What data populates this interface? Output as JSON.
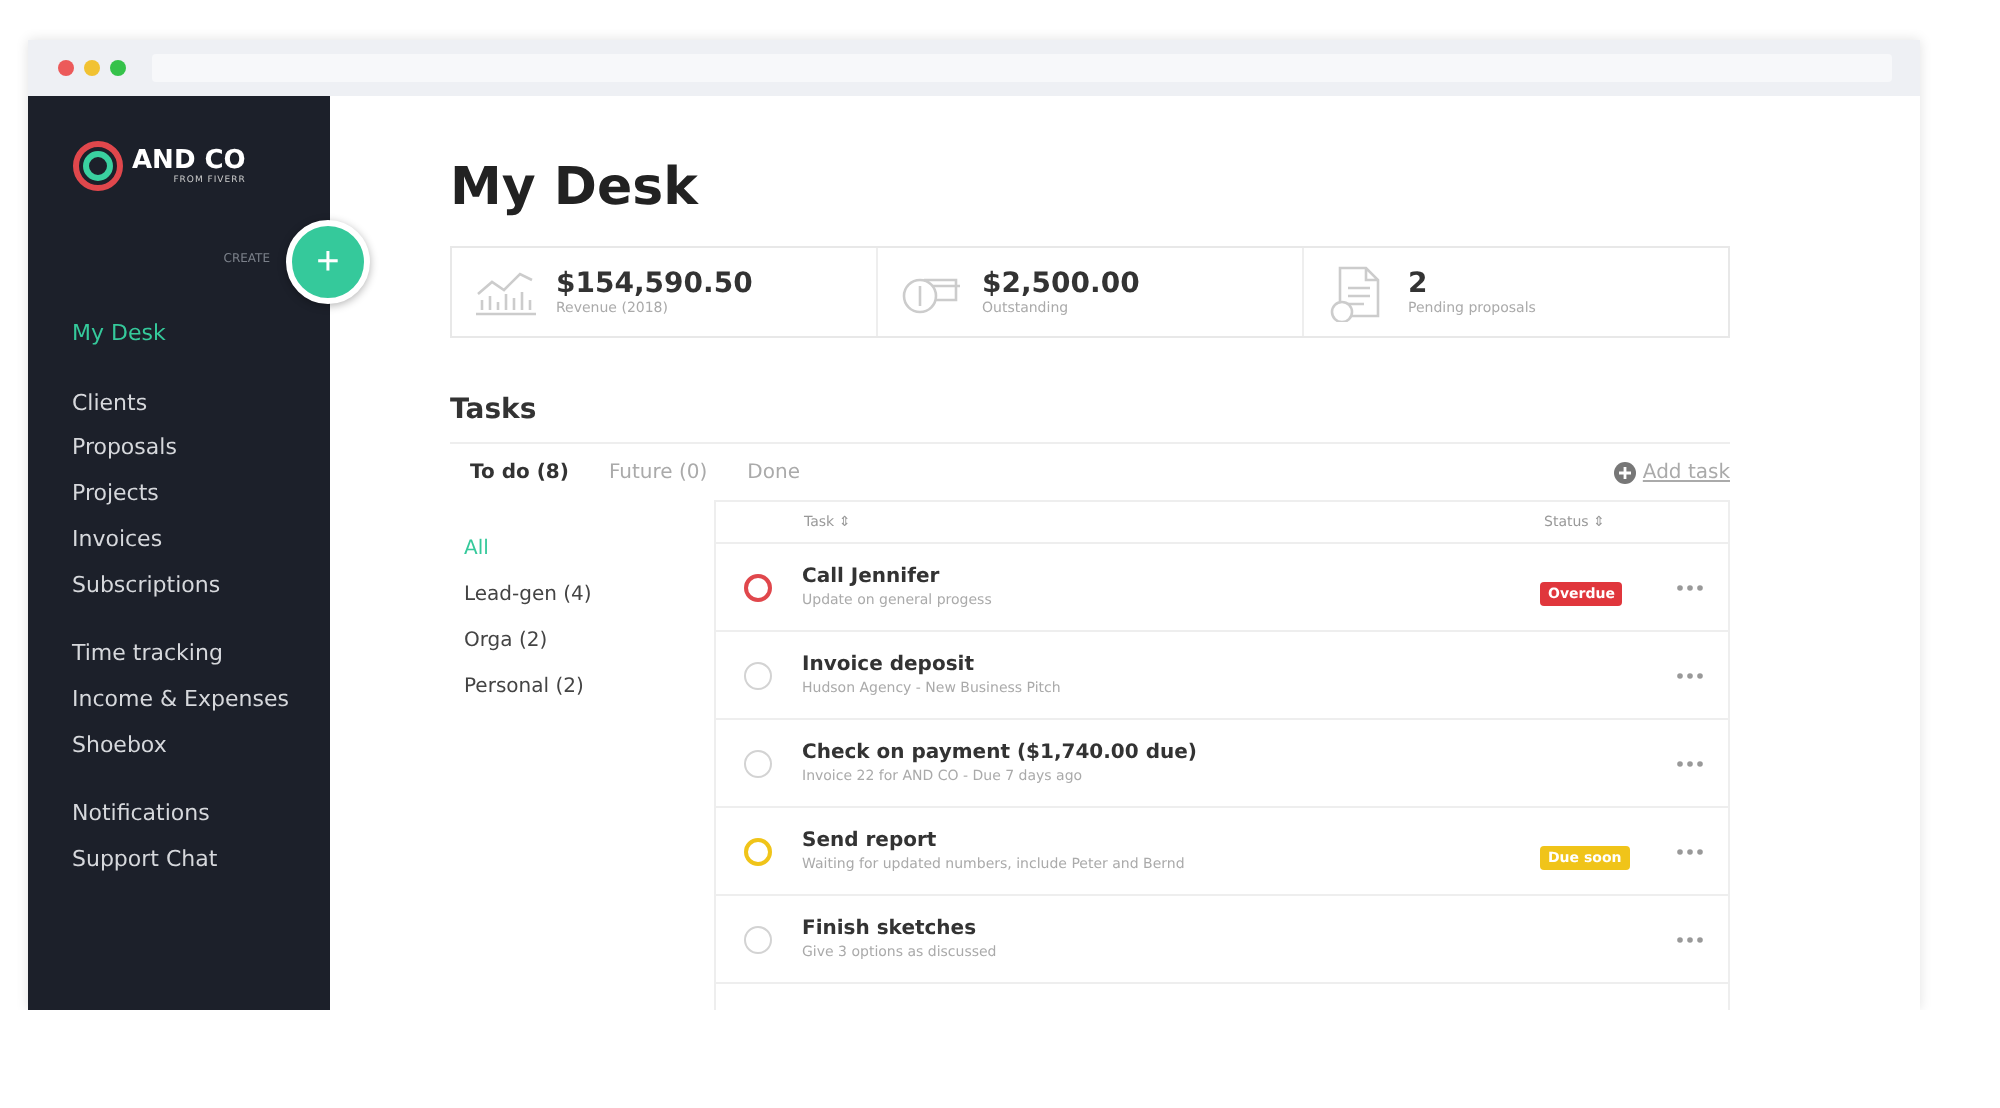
{
  "logo": {
    "name": "AND CO",
    "tagline": "FROM FIVERR"
  },
  "create": {
    "label": "CREATE",
    "icon": "+"
  },
  "sidebar": {
    "groups": [
      [
        {
          "label": "My Desk",
          "selected": true
        }
      ],
      [
        {
          "label": "Clients",
          "selected": false
        },
        {
          "label": "Proposals",
          "selected": false
        },
        {
          "label": "Projects",
          "selected": false
        },
        {
          "label": "Invoices",
          "selected": false
        },
        {
          "label": "Subscriptions",
          "selected": false
        }
      ],
      [
        {
          "label": "Time tracking",
          "selected": false
        },
        {
          "label": "Income & Expenses",
          "selected": false
        },
        {
          "label": "Shoebox",
          "selected": false
        }
      ],
      [
        {
          "label": "Notifications",
          "selected": false
        },
        {
          "label": "Support Chat",
          "selected": false
        }
      ]
    ]
  },
  "title": "My Desk",
  "stats": [
    {
      "kind": "chart",
      "value": "$154,590.50",
      "label": "Revenue (2018)"
    },
    {
      "kind": "money",
      "value": "$2,500.00",
      "label": "Outstanding"
    },
    {
      "kind": "document",
      "value": "2",
      "label": "Pending proposals"
    }
  ],
  "tasks": {
    "heading": "Tasks",
    "tabs": [
      {
        "label": "To do (8)",
        "selected": true
      },
      {
        "label": "Future (0)",
        "selected": false
      },
      {
        "label": "Done",
        "selected": false
      }
    ],
    "add_task": "Add task",
    "filters": [
      {
        "label": "All",
        "selected": true
      },
      {
        "label": "Lead-gen (4)",
        "selected": false
      },
      {
        "label": "Orga (2)",
        "selected": false
      },
      {
        "label": "Personal (2)",
        "selected": false
      }
    ],
    "columns": [
      "Task ⇕",
      "Status ⇕"
    ],
    "rows": [
      {
        "title": "Call Jennifer",
        "subtitle": "Update on general progess",
        "kind": "overdue",
        "status_label": "Overdue"
      },
      {
        "title": "Invoice deposit",
        "subtitle": "Hudson Agency - New Business Pitch",
        "kind": "plain"
      },
      {
        "title": "Check on payment ($1,740.00 due)",
        "subtitle": "Invoice 22 for AND CO - Due 7 days ago",
        "kind": "plain"
      },
      {
        "title": "Send report",
        "subtitle": "Waiting for updated numbers, include Peter and Bernd",
        "kind": "due_soon",
        "status_label": "Due soon"
      },
      {
        "title": "Finish sketches",
        "subtitle": "Give 3 options as discussed",
        "kind": "plain"
      }
    ]
  }
}
